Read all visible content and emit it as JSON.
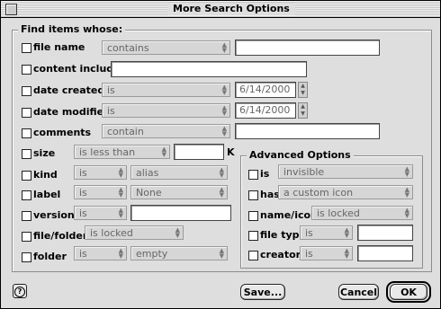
{
  "window": {
    "title": "More Search Options"
  },
  "find": {
    "group_label": "Find items whose:",
    "rows": {
      "file_name": {
        "label": "file name",
        "op": "contains",
        "value": ""
      },
      "content": {
        "label": "content includes",
        "value": ""
      },
      "date_created": {
        "label": "date created",
        "op": "is",
        "value": "6/14/2000"
      },
      "date_modified": {
        "label": "date modified",
        "op": "is",
        "value": "6/14/2000"
      },
      "comments": {
        "label": "comments",
        "op": "contain",
        "value": ""
      },
      "size": {
        "label": "size",
        "op": "is less than",
        "value": "",
        "unit": "K"
      },
      "kind": {
        "label": "kind",
        "op": "is",
        "value": "alias"
      },
      "label": {
        "label": "label",
        "op": "is",
        "value": "None"
      },
      "version": {
        "label": "version",
        "op": "is",
        "value": ""
      },
      "file_folder": {
        "label": "file/folder",
        "op": "is locked"
      },
      "folder": {
        "label": "folder",
        "op": "is",
        "value": "empty"
      }
    }
  },
  "advanced": {
    "group_label": "Advanced Options",
    "rows": {
      "is": {
        "label": "is",
        "op": "invisible"
      },
      "has": {
        "label": "has",
        "op": "a custom icon"
      },
      "name_icon": {
        "label": "name/icon",
        "op": "is locked"
      },
      "file_type": {
        "label": "file type",
        "op": "is",
        "value": ""
      },
      "creator": {
        "label": "creator",
        "op": "is",
        "value": ""
      }
    }
  },
  "buttons": {
    "help": "?",
    "save": "Save...",
    "cancel": "Cancel",
    "ok": "OK"
  }
}
